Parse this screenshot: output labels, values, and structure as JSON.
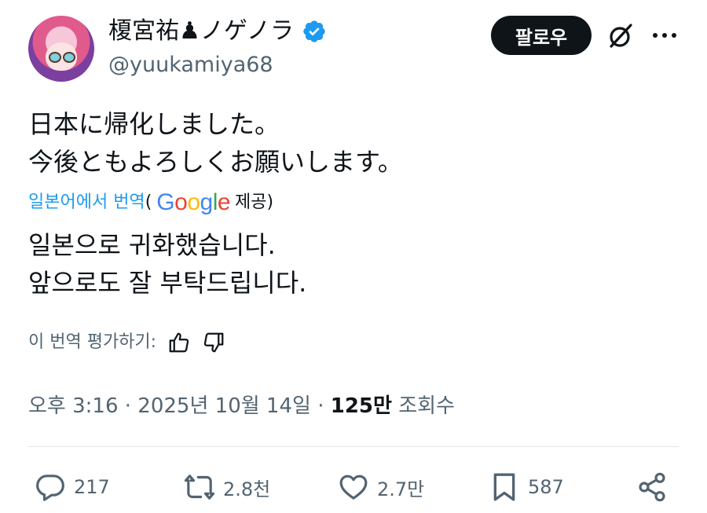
{
  "user": {
    "display_name": "榎宮祐♟ノゲノラ",
    "handle": "@yuukamiya68",
    "verified_icon": "verified-badge-icon",
    "avatar_icon": "avatar-anime-girl"
  },
  "header": {
    "follow_label": "팔로우",
    "grok_icon": "grok-icon",
    "more_icon": "more-dots-icon"
  },
  "post": {
    "original_line1": "日本に帰化しました。",
    "original_line2": "今後ともよろしくお願いします。",
    "translate_link": "일본어에서 번역",
    "translate_open_paren": "(",
    "google_logo": "Google",
    "translate_provided": "제공)",
    "translated_line1": "일본으로 귀화했습니다.",
    "translated_line2": "앞으로도 잘 부탁드립니다.",
    "rate_label": "이 번역 평가하기:"
  },
  "meta": {
    "time": "오후 3:16",
    "sep1": " · ",
    "date": "2025년 10월 14일",
    "sep2": " · ",
    "views_count": "125만",
    "views_label": " 조회수"
  },
  "actions": {
    "replies": "217",
    "reposts": "2.8천",
    "likes": "2.7만",
    "bookmarks": "587"
  },
  "colors": {
    "accent": "#1d9bf0",
    "text": "#0f1419",
    "muted": "#536471",
    "google_blue": "#4285F4",
    "google_red": "#EA4335",
    "google_yellow": "#FBBC05",
    "google_green": "#34A853"
  }
}
